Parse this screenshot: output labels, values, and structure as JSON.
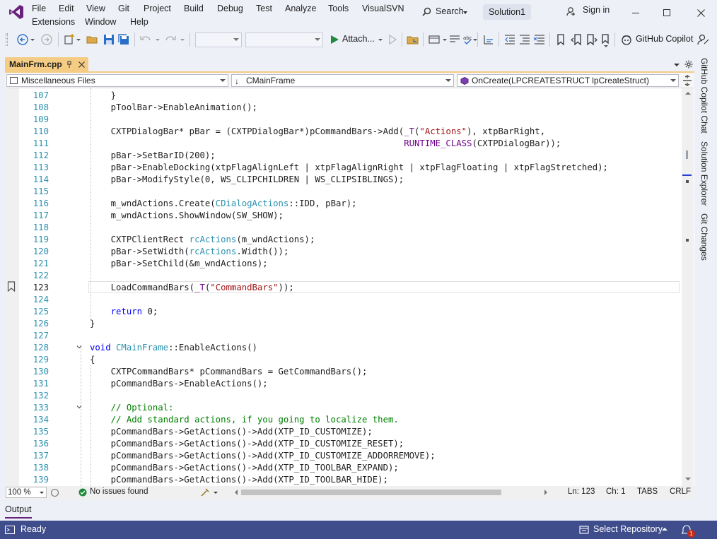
{
  "menu": {
    "items": [
      "File",
      "Edit",
      "View",
      "Git",
      "Project",
      "Build",
      "Debug",
      "Test",
      "Analyze",
      "Tools",
      "VisualSVN"
    ],
    "row2": [
      "Extensions",
      "Window",
      "Help"
    ],
    "search": "Search",
    "solution": "Solution1",
    "signin": "Sign in"
  },
  "toolbar": {
    "attach": "Attach...",
    "copilot": "GitHub Copilot"
  },
  "tab": {
    "name": "MainFrm.cpp"
  },
  "nav": {
    "project": "Miscellaneous Files",
    "scope": "CMainFrame",
    "member": "OnCreate(LPCREATESTRUCT lpCreateStruct)"
  },
  "code_lines": [
    {
      "n": "107",
      "text": "    }"
    },
    {
      "n": "108",
      "text": "    pToolBar->EnableAnimation();"
    },
    {
      "n": "109",
      "text": ""
    },
    {
      "n": "110",
      "text": "    CXTPDialogBar* pBar = (CXTPDialogBar*)pCommandBars->Add(_T(\"Actions\"), xtpBarRight,"
    },
    {
      "n": "111",
      "text": "                                                            RUNTIME_CLASS(CXTPDialogBar));"
    },
    {
      "n": "112",
      "text": "    pBar->SetBarID(200);"
    },
    {
      "n": "113",
      "text": "    pBar->EnableDocking(xtpFlagAlignLeft | xtpFlagAlignRight | xtpFlagFloating | xtpFlagStretched);"
    },
    {
      "n": "114",
      "text": "    pBar->ModifyStyle(0, WS_CLIPCHILDREN | WS_CLIPSIBLINGS);"
    },
    {
      "n": "115",
      "text": ""
    },
    {
      "n": "116",
      "text": "    m_wndActions.Create(CDialogActions::IDD, pBar);"
    },
    {
      "n": "117",
      "text": "    m_wndActions.ShowWindow(SW_SHOW);"
    },
    {
      "n": "118",
      "text": ""
    },
    {
      "n": "119",
      "text": "    CXTPClientRect rcActions(m_wndActions);"
    },
    {
      "n": "120",
      "text": "    pBar->SetWidth(rcActions.Width());"
    },
    {
      "n": "121",
      "text": "    pBar->SetChild(&m_wndActions);"
    },
    {
      "n": "122",
      "text": ""
    },
    {
      "n": "123",
      "text": "    LoadCommandBars(_T(\"CommandBars\"));"
    },
    {
      "n": "124",
      "text": ""
    },
    {
      "n": "125",
      "text": "    return 0;"
    },
    {
      "n": "126",
      "text": "}"
    },
    {
      "n": "127",
      "text": ""
    },
    {
      "n": "128",
      "text": "void CMainFrame::EnableActions()"
    },
    {
      "n": "129",
      "text": "{"
    },
    {
      "n": "130",
      "text": "    CXTPCommandBars* pCommandBars = GetCommandBars();"
    },
    {
      "n": "131",
      "text": "    pCommandBars->EnableActions();"
    },
    {
      "n": "132",
      "text": ""
    },
    {
      "n": "133",
      "text": "    // Optional:"
    },
    {
      "n": "134",
      "text": "    // Add standard actions, if you going to localize them."
    },
    {
      "n": "135",
      "text": "    pCommandBars->GetActions()->Add(XTP_ID_CUSTOMIZE);"
    },
    {
      "n": "136",
      "text": "    pCommandBars->GetActions()->Add(XTP_ID_CUSTOMIZE_RESET);"
    },
    {
      "n": "137",
      "text": "    pCommandBars->GetActions()->Add(XTP_ID_CUSTOMIZE_ADDORREMOVE);"
    },
    {
      "n": "138",
      "text": "    pCommandBars->GetActions()->Add(XTP_ID_TOOLBAR_EXPAND);"
    },
    {
      "n": "139",
      "text": "    pCommandBars->GetActions()->Add(XTP_ID_TOOLBAR_HIDE);"
    }
  ],
  "editor_status": {
    "zoom": "100 %",
    "issues": "No issues found",
    "ln": "Ln: 123",
    "ch": "Ch: 1",
    "tabs": "TABS",
    "eol": "CRLF"
  },
  "output": {
    "label": "Output"
  },
  "status": {
    "ready": "Ready",
    "repo": "Select Repository",
    "notif_count": "1"
  },
  "rail": {
    "copilot_chat": "GitHub Copilot Chat",
    "solution_explorer": "Solution Explorer",
    "git_changes": "Git Changes"
  },
  "colors": {
    "accent": "#68217a",
    "tab": "#f5cc84",
    "status": "#3f4d8c"
  }
}
